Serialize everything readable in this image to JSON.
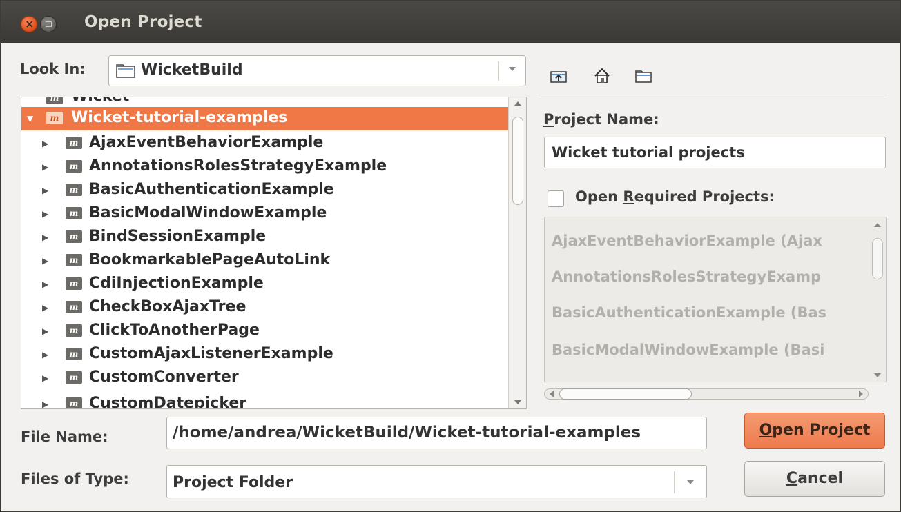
{
  "window": {
    "title": "Open Project"
  },
  "look_in": {
    "label": "Look In:",
    "value": "WicketBuild"
  },
  "toolbar": {
    "icons": [
      "up-folder-icon",
      "home-icon",
      "new-folder-icon"
    ]
  },
  "tree": {
    "partial_top_item": "Wicket",
    "selected_item": "Wicket-tutorial-examples",
    "children": [
      "AjaxEventBehaviorExample",
      "AnnotationsRolesStrategyExample",
      "BasicAuthenticationExample",
      "BasicModalWindowExample",
      "BindSessionExample",
      "BookmarkablePageAutoLink",
      "CdiInjectionExample",
      "CheckBoxAjaxTree",
      "ClickToAnotherPage",
      "CustomAjaxListenerExample",
      "CustomConverter"
    ],
    "partial_bottom_item": "CustomDatepicker",
    "project_icon_text": "m"
  },
  "project_name": {
    "label_prefix": "P",
    "label_rest": "roject Name:",
    "value": "Wicket tutorial projects"
  },
  "required": {
    "label_pre": "Open ",
    "label_mnemonic": "R",
    "label_post": "equired Projects:",
    "checked": false,
    "items": [
      "AjaxEventBehaviorExample (Ajax",
      "AnnotationsRolesStrategyExamp",
      "BasicAuthenticationExample (Bas",
      "BasicModalWindowExample (Basi"
    ]
  },
  "file_name": {
    "label": "File Name:",
    "value": "/home/andrea/WicketBuild/Wicket-tutorial-examples"
  },
  "file_type": {
    "label": "Files of Type:",
    "value": "Project Folder"
  },
  "buttons": {
    "open_mnemonic": "O",
    "open_rest": "pen Project",
    "cancel_mnemonic": "C",
    "cancel_rest": "ancel"
  },
  "colors": {
    "accent": "#f07746",
    "titlebar": "#3c3b37"
  }
}
